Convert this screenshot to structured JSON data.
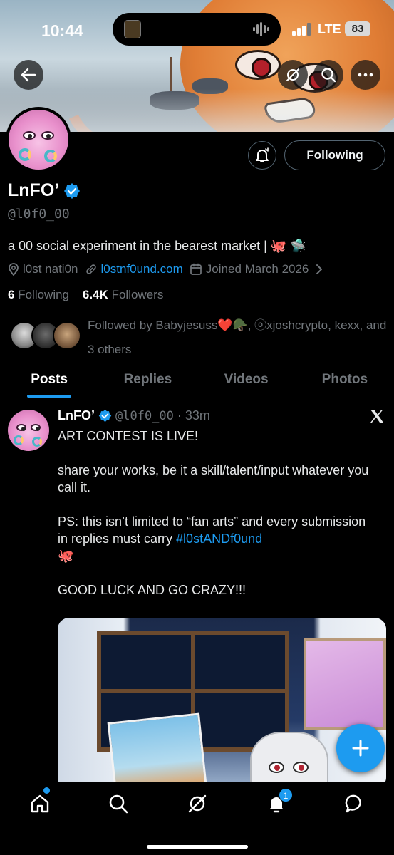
{
  "status_bar": {
    "time": "10:44",
    "network": "LTE",
    "battery": "83"
  },
  "profile": {
    "name": "LnFO’",
    "handle": "@l0f0_00",
    "bio": "a 00 social experiment in the bearest market | 🐙 🛸",
    "location": "l0st nati0n",
    "website": "l0stnf0und.com",
    "joined": "Joined March 2026",
    "following_count": "6",
    "following_label": "Following",
    "followers_count": "6.4K",
    "followers_label": "Followers",
    "followed_by": "Followed by Babyjesuss❤️🪖, ⓞxjoshcrypto, kexx, and 3 others",
    "follow_button": "Following"
  },
  "tabs": [
    {
      "label": "Posts",
      "active": true
    },
    {
      "label": "Replies",
      "active": false
    },
    {
      "label": "Videos",
      "active": false
    },
    {
      "label": "Photos",
      "active": false
    }
  ],
  "post": {
    "author": "LnFO’",
    "handle": "@l0f0_00",
    "sep": "·",
    "time": "33m",
    "line1": "ART CONTEST IS LIVE!",
    "line2": "share your works, be it a skill/talent/input whatever you call it.",
    "line3": "PS: this isn’t limited to “fan arts” and every submission in replies must carry ",
    "hashtag": "#l0stANDf0und",
    "line3_emoji": "🐙",
    "line4": "GOOD LUCK AND GO CRAZY!!!"
  },
  "nav": {
    "notifications_badge": "1"
  },
  "colors": {
    "accent": "#1d9bf0",
    "muted": "#71767b",
    "background": "#000000"
  }
}
